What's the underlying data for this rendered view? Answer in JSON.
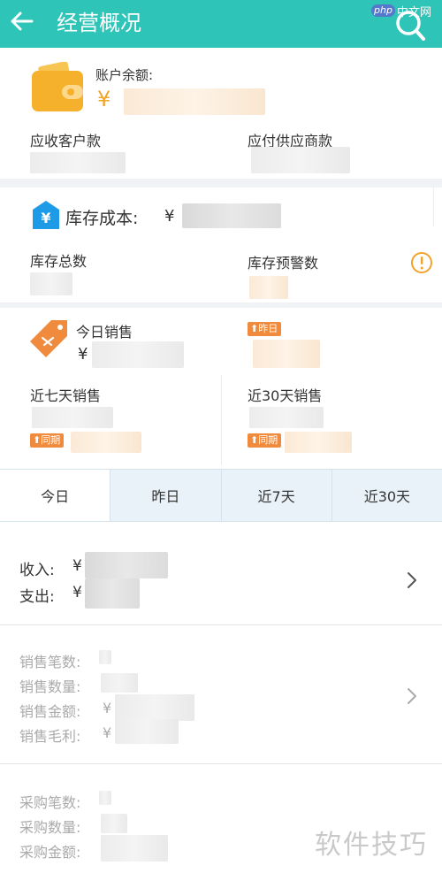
{
  "header": {
    "title": "经营概况",
    "brand_php": "php",
    "brand_cn": "中文网"
  },
  "balance": {
    "label": "账户余额:",
    "currency": "¥",
    "receivable_label": "应收客户款",
    "payable_label": "应付供应商款"
  },
  "inventory": {
    "cost_label": "库存成本:",
    "currency": "¥",
    "total_label": "库存总数",
    "warning_label": "库存预警数"
  },
  "sales": {
    "today_label": "今日销售",
    "currency": "¥",
    "badge_yesterday": "昨日",
    "week_label": "近七天销售",
    "month_label": "近30天销售",
    "badge_period": "同期",
    "badge_period_right": "同期"
  },
  "tabs": [
    {
      "label": "今日"
    },
    {
      "label": "昨日"
    },
    {
      "label": "近7天"
    },
    {
      "label": "近30天"
    }
  ],
  "summary": {
    "income_label": "收入:",
    "expense_label": "支出:",
    "currency": "¥"
  },
  "sales_stats": {
    "count_label": "销售笔数:",
    "quantity_label": "销售数量:",
    "amount_label": "销售金额:",
    "profit_label": "销售毛利:",
    "currency": "¥"
  },
  "purchase_stats": {
    "count_label": "采购笔数:",
    "quantity_label": "采购数量:",
    "amount_label": "采购金额:"
  },
  "watermark": "软件技巧",
  "colors": {
    "header": "#2ec4b8",
    "accent_orange": "#f08a3c",
    "yen_gold": "#f1a32a",
    "icon_blue": "#1e9be6"
  }
}
